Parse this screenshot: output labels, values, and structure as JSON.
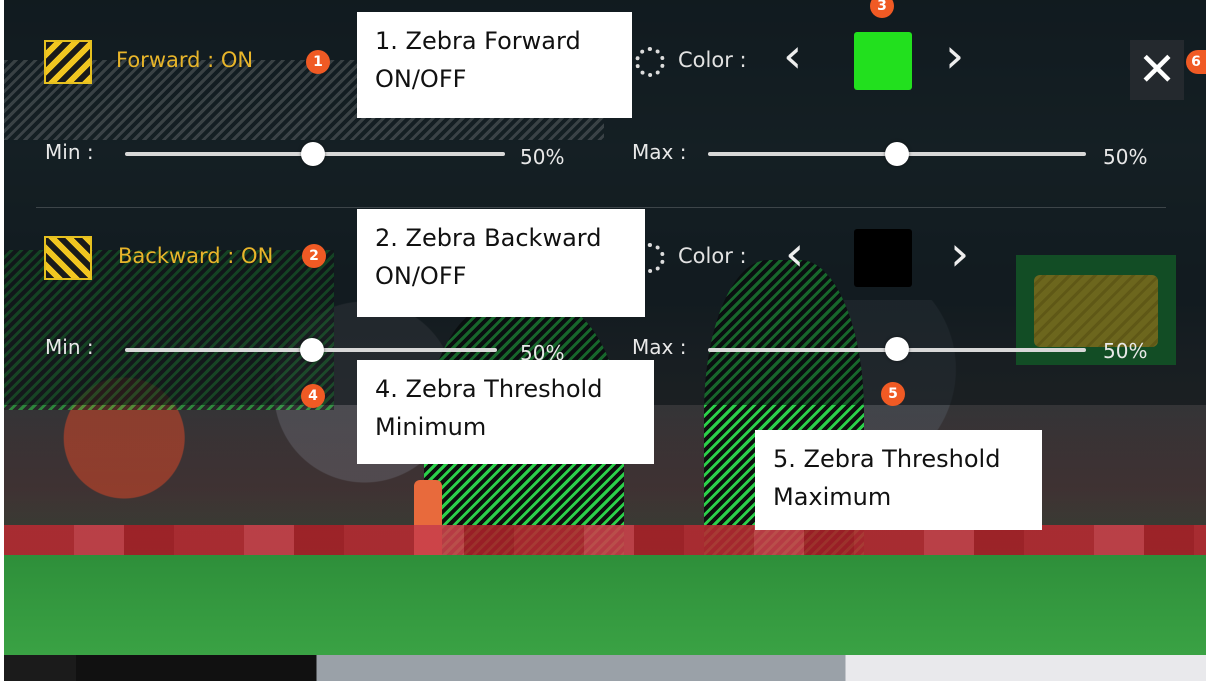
{
  "forward": {
    "toggle_label": "Forward : ON",
    "badge": "1",
    "color_label": "Color :",
    "color_badge": "3",
    "swatch_color": "#22e01e",
    "min_label": "Min :",
    "min_value": "50%",
    "min_level": 0.5,
    "max_label": "Max :",
    "max_value": "50%",
    "max_level": 0.5
  },
  "backward": {
    "toggle_label": "Backward : ON",
    "badge": "2",
    "color_label": "Color :",
    "swatch_color": "#000000",
    "min_label": "Min :",
    "min_value": "50%",
    "min_badge": "4",
    "min_level": 0.5,
    "max_label": "Max :",
    "max_value": "50%",
    "max_badge": "5",
    "max_level": 0.5
  },
  "close": {
    "glyph": "✕",
    "badge": "6"
  },
  "chevrons": {
    "prev": "‹",
    "next": "›"
  },
  "callouts": {
    "c1": [
      "1. Zebra Forward",
      "ON/OFF"
    ],
    "c2": [
      "2. Zebra Backward",
      "ON/OFF"
    ],
    "c4": [
      "4. Zebra Threshold",
      "Minimum"
    ],
    "c5": [
      "5. Zebra Threshold",
      "Maximum"
    ]
  },
  "colors": {
    "accent": "#e8b52a",
    "badge": "#f05a24"
  }
}
